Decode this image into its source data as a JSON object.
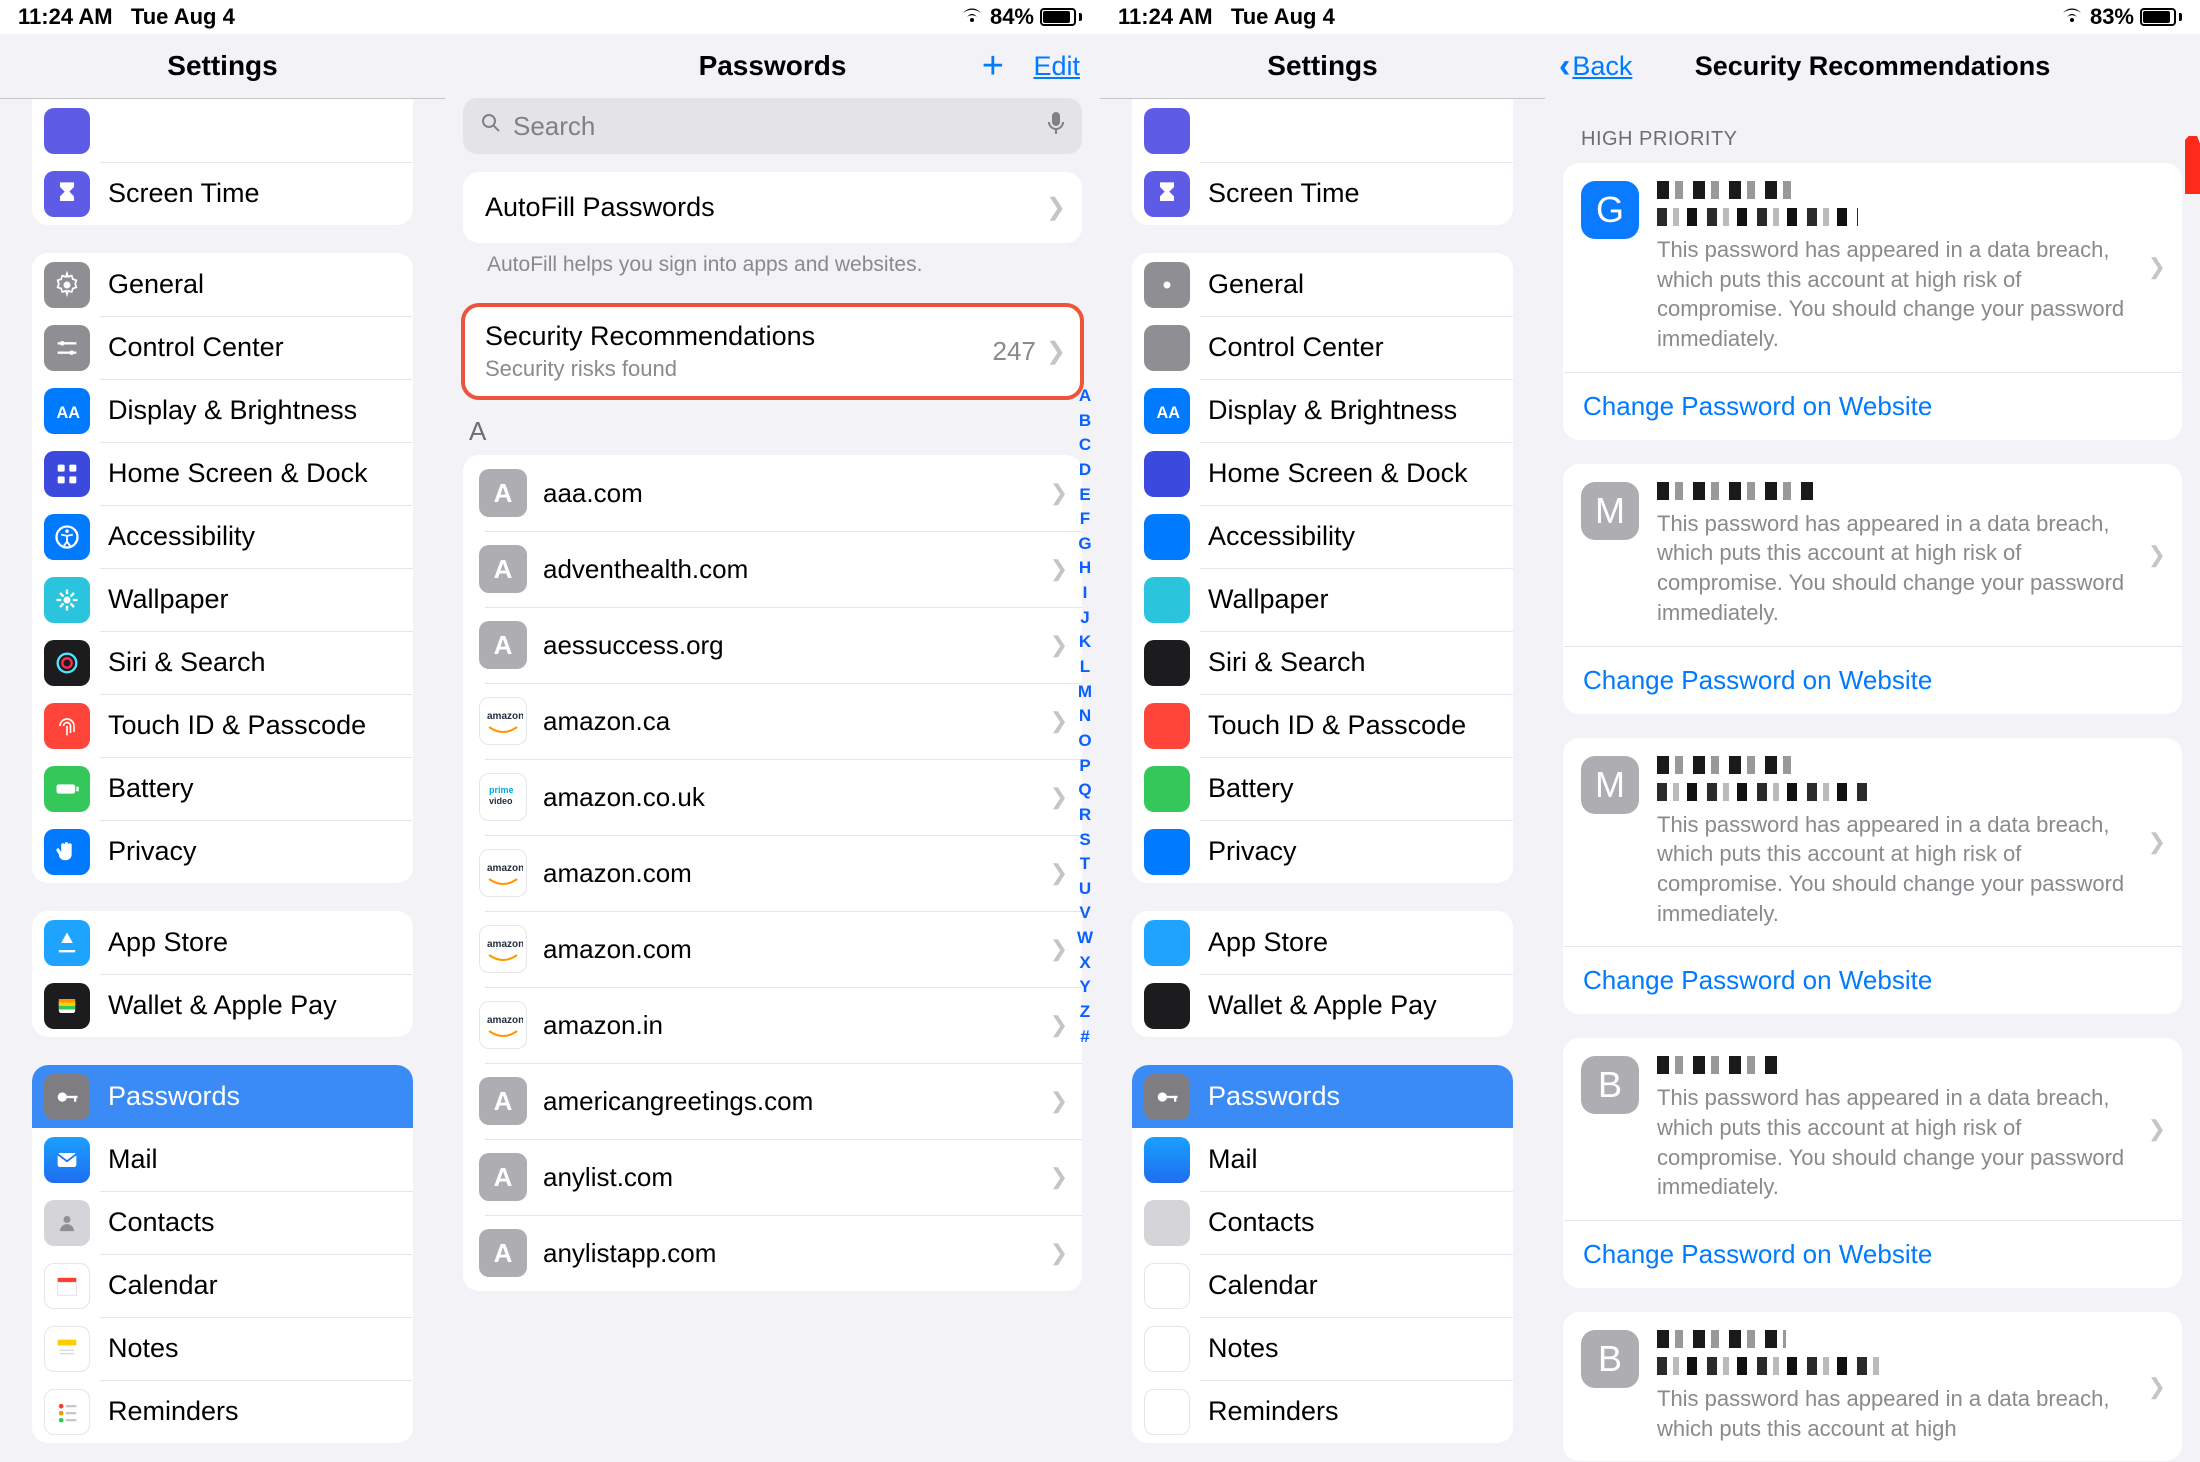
{
  "status": {
    "time": "11:24 AM",
    "date": "Tue Aug 4",
    "battery_left": "84%",
    "battery_left_pct": 84,
    "battery_right": "83%",
    "battery_right_pct": 83
  },
  "settings_title": "Settings",
  "sidebar": {
    "screen_time": "Screen Time",
    "general": "General",
    "control_center": "Control Center",
    "display": "Display & Brightness",
    "home_dock": "Home Screen & Dock",
    "accessibility": "Accessibility",
    "wallpaper": "Wallpaper",
    "siri": "Siri & Search",
    "touchid": "Touch ID & Passcode",
    "battery": "Battery",
    "privacy": "Privacy",
    "app_store": "App Store",
    "wallet": "Wallet & Apple Pay",
    "passwords": "Passwords",
    "mail": "Mail",
    "contacts": "Contacts",
    "calendar": "Calendar",
    "notes": "Notes",
    "reminders": "Reminders"
  },
  "passwords": {
    "title": "Passwords",
    "edit": "Edit",
    "search_placeholder": "Search",
    "autofill_label": "AutoFill Passwords",
    "autofill_footer": "AutoFill helps you sign into apps and websites.",
    "secrec_title": "Security Recommendations",
    "secrec_sub": "Security risks found",
    "secrec_count": "247",
    "section_A": "A",
    "items": [
      {
        "avatar": "A",
        "site": "aaa.com",
        "style": "letter"
      },
      {
        "avatar": "A",
        "site": "adventhealth.com",
        "style": "letter"
      },
      {
        "avatar": "A",
        "site": "aessuccess.org",
        "style": "letter"
      },
      {
        "avatar": "az",
        "site": "amazon.ca",
        "style": "amazon"
      },
      {
        "avatar": "pv",
        "site": "amazon.co.uk",
        "style": "primevideo"
      },
      {
        "avatar": "az",
        "site": "amazon.com",
        "style": "amazon"
      },
      {
        "avatar": "az",
        "site": "amazon.com",
        "style": "amazon"
      },
      {
        "avatar": "az",
        "site": "amazon.in",
        "style": "amazon"
      },
      {
        "avatar": "A",
        "site": "americangreetings.com",
        "style": "letter"
      },
      {
        "avatar": "A",
        "site": "anylist.com",
        "style": "letter"
      },
      {
        "avatar": "A",
        "site": "anylistapp.com",
        "style": "letter"
      }
    ],
    "index_chars": [
      "A",
      "B",
      "C",
      "D",
      "E",
      "F",
      "G",
      "H",
      "I",
      "J",
      "K",
      "L",
      "M",
      "N",
      "O",
      "P",
      "Q",
      "R",
      "S",
      "T",
      "U",
      "V",
      "W",
      "X",
      "Y",
      "Z",
      "#"
    ]
  },
  "secrec": {
    "back": "Back",
    "title": "Security Recommendations",
    "section": "HIGH PRIORITY",
    "breach_text": "This password has appeared in a data breach, which puts this account at high risk of compromise. You should change your password immediately.",
    "breach_text_short": "This password has appeared in a data breach, which puts this account at high",
    "change_link": "Change Password on Website",
    "recs": [
      {
        "letter": "G",
        "avclass": "avG"
      },
      {
        "letter": "M",
        "avclass": "avM"
      },
      {
        "letter": "M",
        "avclass": "avM"
      },
      {
        "letter": "B",
        "avclass": "avB"
      },
      {
        "letter": "B",
        "avclass": "avB"
      }
    ]
  }
}
